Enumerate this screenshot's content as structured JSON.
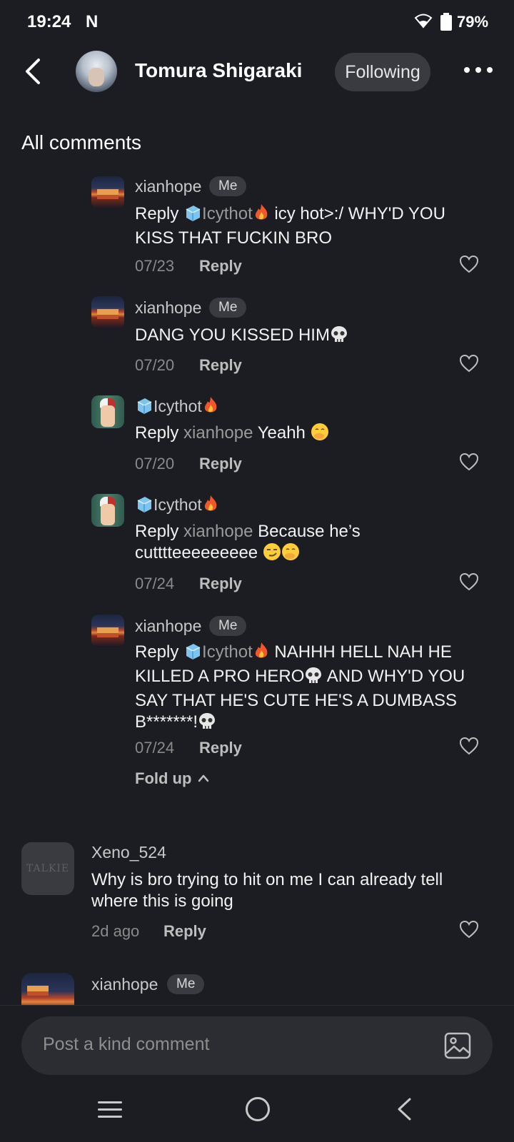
{
  "status_bar": {
    "time": "19:24",
    "app_indicator": "N",
    "battery": "79%"
  },
  "header": {
    "name": "Tomura Shigaraki",
    "follow_label": "Following"
  },
  "section_title": "All comments",
  "replies": [
    {
      "username": "xianhope",
      "badge": "Me",
      "reply_word": "Reply",
      "mention": "Icythot",
      "text_line1_suffix": " icy hot>:/ WHY'D YOU",
      "text_line2": "KISS THAT FUCKIN BRO",
      "date": "07/23",
      "reply_label": "Reply"
    },
    {
      "username": "xianhope",
      "badge": "Me",
      "text": "DANG YOU KISSED HIM",
      "date": "07/20",
      "reply_label": "Reply"
    },
    {
      "username": "Icythot",
      "reply_word": "Reply",
      "mention": "xianhope",
      "text": " Yeahh",
      "date": "07/20",
      "reply_label": "Reply"
    },
    {
      "username": "Icythot",
      "reply_word": "Reply",
      "mention": "xianhope",
      "text_line1_suffix": " Because he’s",
      "text_line2": "cutttteeeeeeeee",
      "date": "07/24",
      "reply_label": "Reply"
    },
    {
      "username": "xianhope",
      "badge": "Me",
      "reply_word": "Reply",
      "mention": "Icythot",
      "text_line1_suffix": " NAHHH HELL NAH HE",
      "text_line2": "KILLED A PRO HERO",
      "text_line2_suffix": " AND WHY'D YOU",
      "text_line3": "SAY THAT HE'S CUTE HE'S A DUMBASS",
      "text_line4": "B*******!",
      "date": "07/24",
      "reply_label": "Reply"
    }
  ],
  "fold_up_label": "Fold up",
  "comments": [
    {
      "avatar_text": "TALKIE",
      "username": "Xeno_524",
      "text_line1": "Why is bro trying to hit on me I can already tell",
      "text_line2": "where this is going",
      "date": "2d ago",
      "reply_label": "Reply"
    },
    {
      "username": "xianhope",
      "badge": "Me"
    }
  ],
  "input": {
    "placeholder": "Post a kind comment"
  },
  "icons": {
    "back": "back-arrow-icon",
    "more": "more-dots-icon",
    "heart": "heart-outline-icon",
    "image": "image-icon",
    "ice": "ice-cube-emoji",
    "fire": "fire-emoji",
    "skull": "skull-emoji"
  },
  "colors": {
    "background": "#1c1d22",
    "pill": "#3a3b40",
    "muted": "#8a8a8a"
  }
}
